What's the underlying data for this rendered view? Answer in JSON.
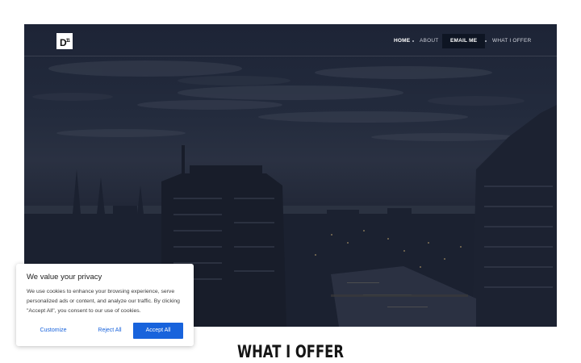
{
  "header": {
    "logo_text": "D",
    "logo_sup": "11",
    "nav": [
      {
        "label": "HOME"
      },
      {
        "label": "ABOUT"
      },
      {
        "label": "EMAIL ME"
      },
      {
        "label": "WHAT I OFFER"
      }
    ]
  },
  "hero": {
    "image": "city-skyline-at-dusk"
  },
  "cookie_banner": {
    "title": "We value your privacy",
    "text": "We use cookies to enhance your browsing experience, serve personalized ads or content, and analyze our traffic. By clicking \"Accept All\", you consent to our use of cookies.",
    "customize_label": "Customize",
    "reject_label": "Reject All",
    "accept_label": "Accept All",
    "accent_color": "#1863dc"
  },
  "section": {
    "title": "WHAT I OFFER"
  }
}
